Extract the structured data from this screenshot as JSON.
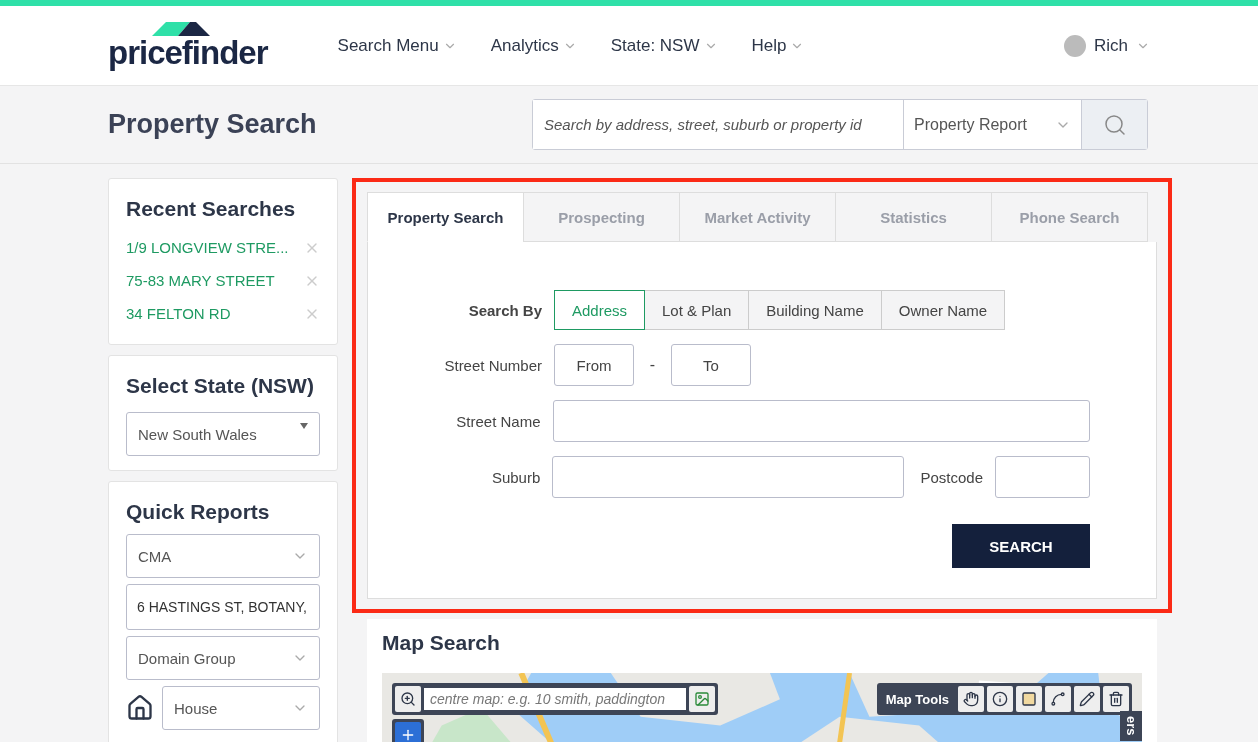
{
  "header": {
    "logo": "pricefinder",
    "nav": [
      "Search Menu",
      "Analytics",
      "State: NSW",
      "Help"
    ],
    "user": "Rich"
  },
  "subheader": {
    "title": "Property Search",
    "search": {
      "placeholder": "Search by address, street, suburb or property id"
    },
    "report_type": "Property Report"
  },
  "sidebar": {
    "recent_searches": {
      "title": "Recent Searches",
      "items": [
        "1/9 LONGVIEW STRE...",
        "75-83 MARY STREET",
        "34 FELTON RD"
      ]
    },
    "select_state": {
      "title": "Select State (NSW)",
      "value": "New South Wales"
    },
    "quick_reports": {
      "title": "Quick Reports",
      "report": "CMA",
      "address": "6 HASTINGS ST, BOTANY,",
      "provider": "Domain Group",
      "property_type": "House"
    }
  },
  "search_panel": {
    "highlighted": true,
    "tabs": [
      {
        "label": "Property Search",
        "selected": true
      },
      {
        "label": "Prospecting",
        "selected": false
      },
      {
        "label": "Market Activity",
        "selected": false
      },
      {
        "label": "Statistics",
        "selected": false
      },
      {
        "label": "Phone Search",
        "selected": false
      }
    ],
    "search_by_label": "Search By",
    "search_by": [
      {
        "label": "Address",
        "selected": true
      },
      {
        "label": "Lot & Plan",
        "selected": false
      },
      {
        "label": "Building Name",
        "selected": false
      },
      {
        "label": "Owner Name",
        "selected": false
      }
    ],
    "street_number": {
      "label": "Street Number",
      "from": {
        "placeholder": "From"
      },
      "separator": "-",
      "to": {
        "placeholder": "To"
      }
    },
    "street_name": {
      "label": "Street Name"
    },
    "suburb": {
      "label": "Suburb"
    },
    "postcode": {
      "label": "Postcode"
    },
    "submit": "SEARCH"
  },
  "map_search": {
    "title": "Map Search",
    "centre_field": {
      "placeholder": "centre map: e.g. 10 smith, paddington"
    },
    "tools_label": "Map Tools",
    "side_tab": "ers"
  }
}
